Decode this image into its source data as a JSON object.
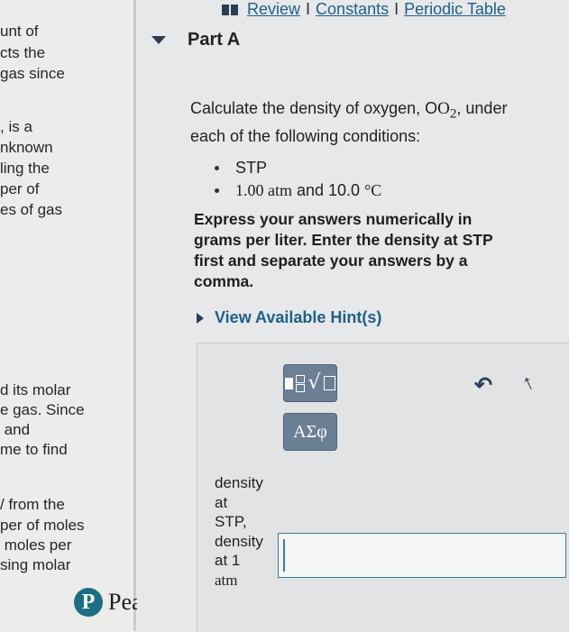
{
  "left_fragments": [
    {
      "text": "unt of"
    },
    {
      "text": "cts the"
    },
    {
      "text": "gas since"
    },
    {
      "text": ", is a"
    },
    {
      "text": "nknown"
    },
    {
      "text": "ling the"
    },
    {
      "text": "per of"
    },
    {
      "text": "es of gas"
    },
    {
      "text": "d its molar"
    },
    {
      "text": "e gas. Since"
    },
    {
      "text": " and"
    },
    {
      "text": "me to find"
    },
    {
      "text": "/ from the"
    },
    {
      "text": "per of moles"
    },
    {
      "text": " moles per"
    },
    {
      "text": "sing molar"
    }
  ],
  "brand": {
    "logo_letter": "P",
    "name": "Pearson"
  },
  "toplinks": {
    "review": "Review",
    "constants": "Constants",
    "periodic": "Periodic Table",
    "sep": "I"
  },
  "part": {
    "title": "Part A"
  },
  "question": {
    "text_before": "Calculate the density of oxygen, O",
    "subscript": "2",
    "text_after": ", under each of the following conditions:"
  },
  "conditions": {
    "item1": "STP",
    "item2_value": "1.00 atm",
    "item2_and": " and 10.0 ",
    "item2_unit": "°C"
  },
  "instruction": "Express your answers numerically in grams per liter. Enter the density at STP first and separate your answers by a comma.",
  "hint": {
    "label": "View Available Hint(s)"
  },
  "toolbar": {
    "greek_label": "ΑΣφ"
  },
  "answer": {
    "label_line1": "density",
    "label_line2": "at",
    "label_line3": "STP,",
    "label_line4": "density",
    "label_line5": "at 1",
    "label_line6": "atm",
    "value": ""
  },
  "icons": {
    "book": "book-icon",
    "collapse": "caret-down-icon",
    "expand": "caret-right-icon",
    "undo": "undo-icon",
    "redo": "redo-icon",
    "templates": "templates-icon"
  },
  "colors": {
    "link": "#1f5f8a",
    "button": "#6b7f95",
    "input_border": "#3f7c9a",
    "logo": "#1b6f84"
  }
}
